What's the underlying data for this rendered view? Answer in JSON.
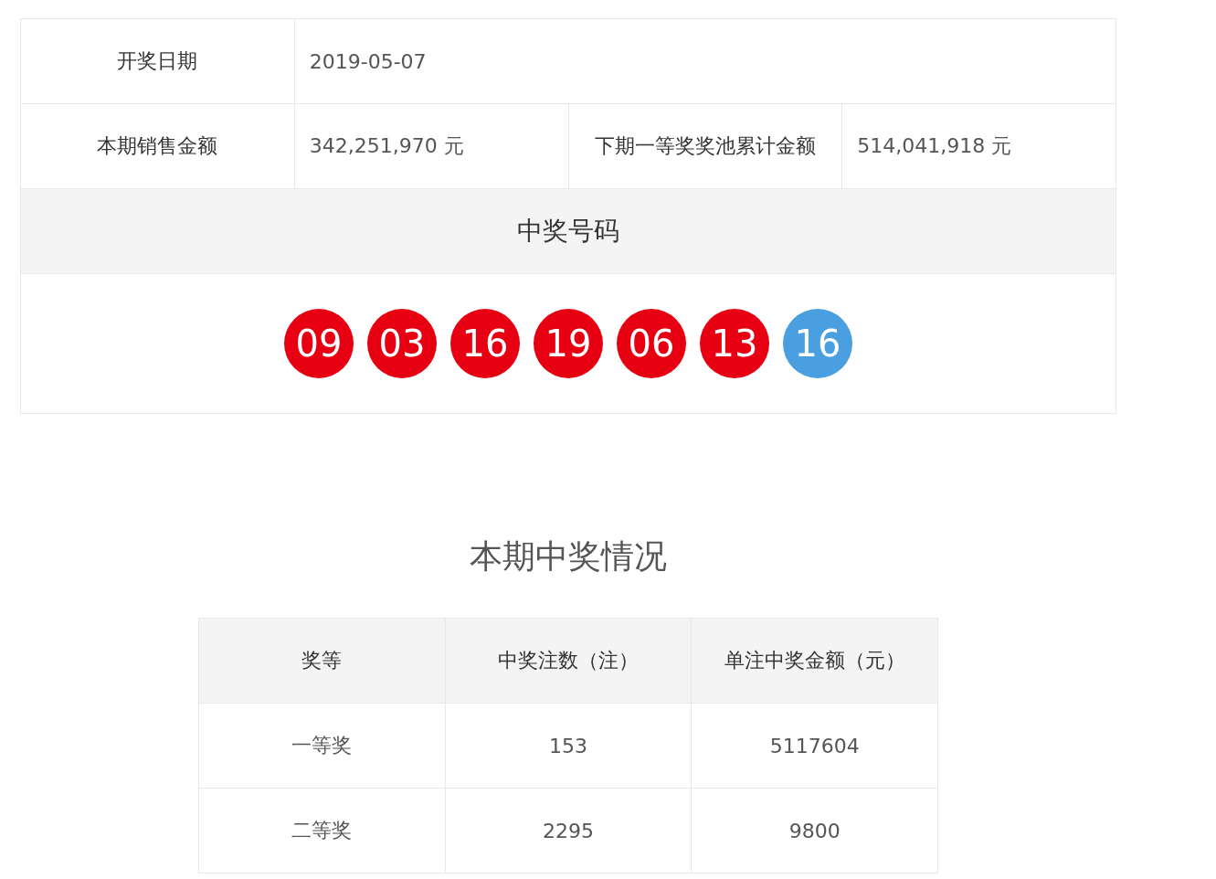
{
  "draw_info": {
    "date_label": "开奖日期",
    "date": "2019-05-07",
    "sales_label": "本期销售金额",
    "sales": "342,251,970 元",
    "pool_label": "下期一等奖奖池累计金额",
    "pool": "514,041,918 元"
  },
  "winning_numbers": {
    "title": "中奖号码",
    "balls": [
      {
        "number": "09",
        "color": "#e60012"
      },
      {
        "number": "03",
        "color": "#e60012"
      },
      {
        "number": "16",
        "color": "#e60012"
      },
      {
        "number": "19",
        "color": "#e60012"
      },
      {
        "number": "06",
        "color": "#e60012"
      },
      {
        "number": "13",
        "color": "#e60012"
      },
      {
        "number": "16",
        "color": "#4a9fe0"
      }
    ]
  },
  "prize_section": {
    "title": "本期中奖情况",
    "columns": [
      "奖等",
      "中奖注数（注）",
      "单注中奖金额（元）"
    ],
    "rows": [
      [
        "一等奖",
        "153",
        "5117604"
      ],
      [
        "二等奖",
        "2295",
        "9800"
      ]
    ]
  }
}
